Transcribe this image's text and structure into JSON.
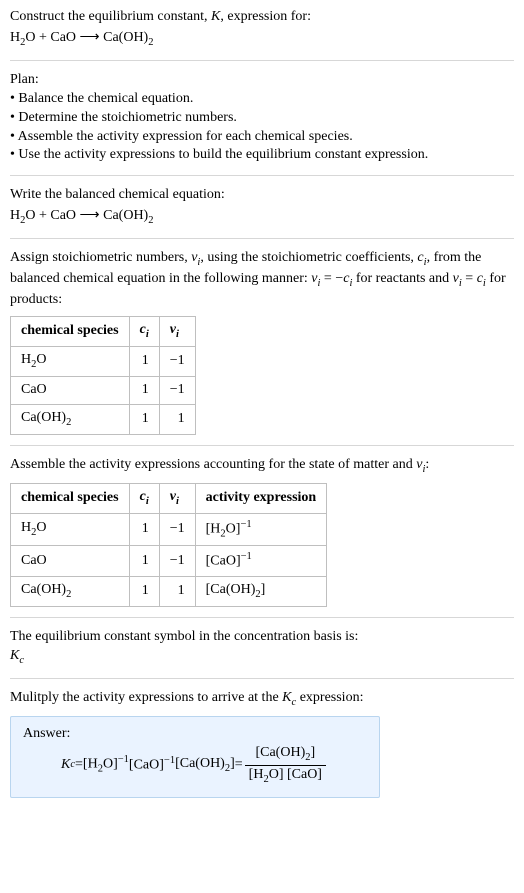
{
  "intro": {
    "line1": "Construct the equilibrium constant, ",
    "K": "K",
    "line1_after": ", expression for:",
    "eq_lhs1": "H",
    "eq_lhs1_sub": "2",
    "eq_lhs1_o": "O + CaO ",
    "arrow": "⟶",
    "eq_rhs": " Ca(OH)",
    "eq_rhs_sub": "2"
  },
  "plan": {
    "heading": "Plan:",
    "bullet": "•",
    "item1": " Balance the chemical equation.",
    "item2": " Determine the stoichiometric numbers.",
    "item3": " Assemble the activity expression for each chemical species.",
    "item4": " Use the activity expressions to build the equilibrium constant expression."
  },
  "balanced": {
    "heading": "Write the balanced chemical equation:",
    "lhs1": "H",
    "lhs1_sub": "2",
    "lhs1_o": "O + CaO ",
    "arrow": "⟶",
    "rhs": " Ca(OH)",
    "rhs_sub": "2"
  },
  "assign": {
    "text1": "Assign stoichiometric numbers, ",
    "nu_i": "ν",
    "i_sub": "i",
    "text2": ", using the stoichiometric coefficients, ",
    "c_i": "c",
    "text3": ", from the balanced chemical equation in the following manner: ",
    "rel1_l": "ν",
    "rel1_eq": " = −",
    "rel1_r": "c",
    "text4": " for reactants and ",
    "rel2_eq": " = ",
    "text5": " for products:"
  },
  "table1": {
    "h1": "chemical species",
    "h2": "c",
    "h2_sub": "i",
    "h3": "ν",
    "h3_sub": "i",
    "r1c1a": "H",
    "r1c1b": "2",
    "r1c1c": "O",
    "r1c2": "1",
    "r1c3": "−1",
    "r2c1": "CaO",
    "r2c2": "1",
    "r2c3": "−1",
    "r3c1a": "Ca(OH)",
    "r3c1b": "2",
    "r3c2": "1",
    "r3c3": "1"
  },
  "assemble": {
    "text1": "Assemble the activity expressions accounting for the state of matter and ",
    "nu": "ν",
    "i_sub": "i",
    "colon": ":"
  },
  "table2": {
    "h1": "chemical species",
    "h2": "c",
    "h2_sub": "i",
    "h3": "ν",
    "h3_sub": "i",
    "h4": "activity expression",
    "r1c1a": "H",
    "r1c1b": "2",
    "r1c1c": "O",
    "r1c2": "1",
    "r1c3": "−1",
    "r1c4a": "[H",
    "r1c4b": "2",
    "r1c4c": "O]",
    "r1c4exp": "−1",
    "r2c1": "CaO",
    "r2c2": "1",
    "r2c3": "−1",
    "r2c4a": "[CaO]",
    "r2c4exp": "−1",
    "r3c1a": "Ca(OH)",
    "r3c1b": "2",
    "r3c2": "1",
    "r3c3": "1",
    "r3c4a": "[Ca(OH)",
    "r3c4b": "2",
    "r3c4c": "]"
  },
  "symbol": {
    "text": "The equilibrium constant symbol in the concentration basis is:",
    "K": "K",
    "c_sub": "c"
  },
  "multiply": {
    "text1": "Mulitply the activity expressions to arrive at the ",
    "K": "K",
    "c_sub": "c",
    "text2": " expression:"
  },
  "answer": {
    "label": "Answer:",
    "K": "K",
    "c_sub": "c",
    "eq": " = ",
    "t1a": "[H",
    "t1b": "2",
    "t1c": "O]",
    "t1exp": "−1",
    "t2a": " [CaO]",
    "t2exp": "−1",
    "t3a": " [Ca(OH)",
    "t3b": "2",
    "t3c": "] ",
    "eq2": "= ",
    "num_a": "[Ca(OH)",
    "num_b": "2",
    "num_c": "]",
    "den_a": "[H",
    "den_b": "2",
    "den_c": "O] [CaO]"
  }
}
